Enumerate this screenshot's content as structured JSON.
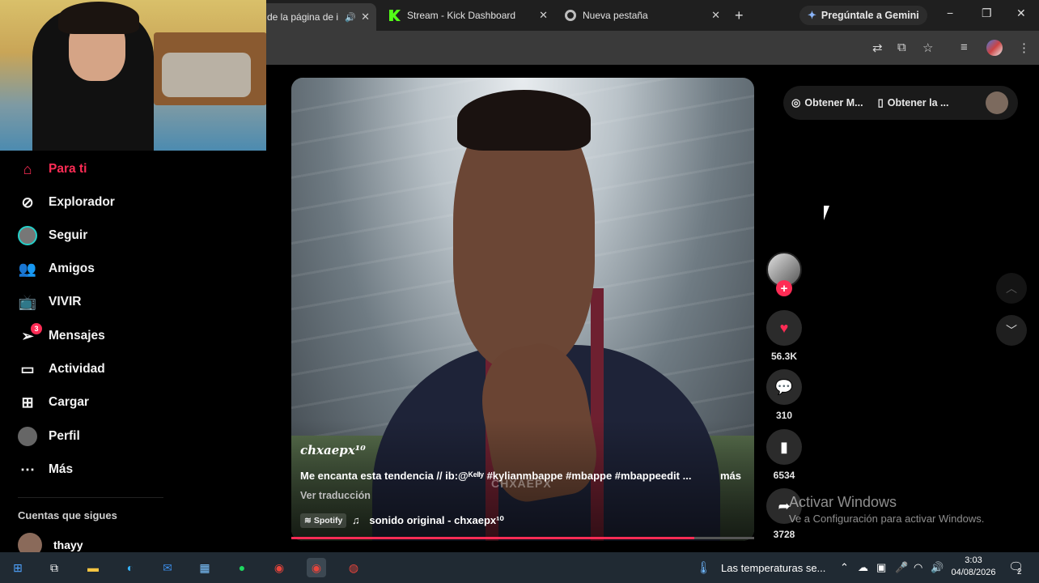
{
  "browser": {
    "tabs": [
      {
        "label": "de la página de i",
        "active": true,
        "audio": true
      },
      {
        "label": "Stream - Kick Dashboard",
        "active": false
      },
      {
        "label": "Nueva pestaña",
        "active": false
      }
    ],
    "new_tab": "+",
    "gemini_label": "Pregúntale a Gemini",
    "window_controls": [
      "−",
      "❐",
      "✕"
    ]
  },
  "sidebar": {
    "items": [
      {
        "label": "Para ti",
        "icon": "home-icon",
        "active": true
      },
      {
        "label": "Explorador",
        "icon": "compass-icon"
      },
      {
        "label": "Seguir",
        "icon": "following-avatar"
      },
      {
        "label": "Amigos",
        "icon": "friends-icon"
      },
      {
        "label": "VIVIR",
        "icon": "live-tv-icon"
      },
      {
        "label": "Mensajes",
        "icon": "messages-icon",
        "badge": "3"
      },
      {
        "label": "Actividad",
        "icon": "activity-icon"
      },
      {
        "label": "Cargar",
        "icon": "upload-icon"
      },
      {
        "label": "Perfil",
        "icon": "profile-avatar"
      },
      {
        "label": "Más",
        "icon": "more-icon"
      }
    ],
    "following_title": "Cuentas que sigues",
    "following_accounts": [
      {
        "name": "thayy"
      }
    ]
  },
  "video": {
    "author": "chxaepx¹⁰",
    "description": "Me encanta esta tendencia // ib:@ᴷᵉˡˡʸ #kylianmbappe #mbappe #mbappeedit ...",
    "more_label": "más",
    "watermark": "CHXAEPX",
    "translate_label": "Ver traducción",
    "spotify_label": "Spotify",
    "music_label": "sonido original - chxaepx¹⁰",
    "progress": 0.87
  },
  "actions": {
    "likes": "56.3K",
    "comments": "310",
    "saves": "6534",
    "shares": "3728",
    "follow_plus": "+"
  },
  "top_right": {
    "item1": "Obtener M...",
    "item2": "Obtener la ..."
  },
  "windows_activation": {
    "title": "Activar Windows",
    "subtitle": "Ve a Configuración para activar Windows."
  },
  "taskbar": {
    "weather_text": "Las temperaturas se...",
    "time": "3:03",
    "date": "04/08/2026",
    "notifications": "2"
  },
  "colors": {
    "accent": "#fe2c55",
    "taskbar": "#202a33"
  }
}
